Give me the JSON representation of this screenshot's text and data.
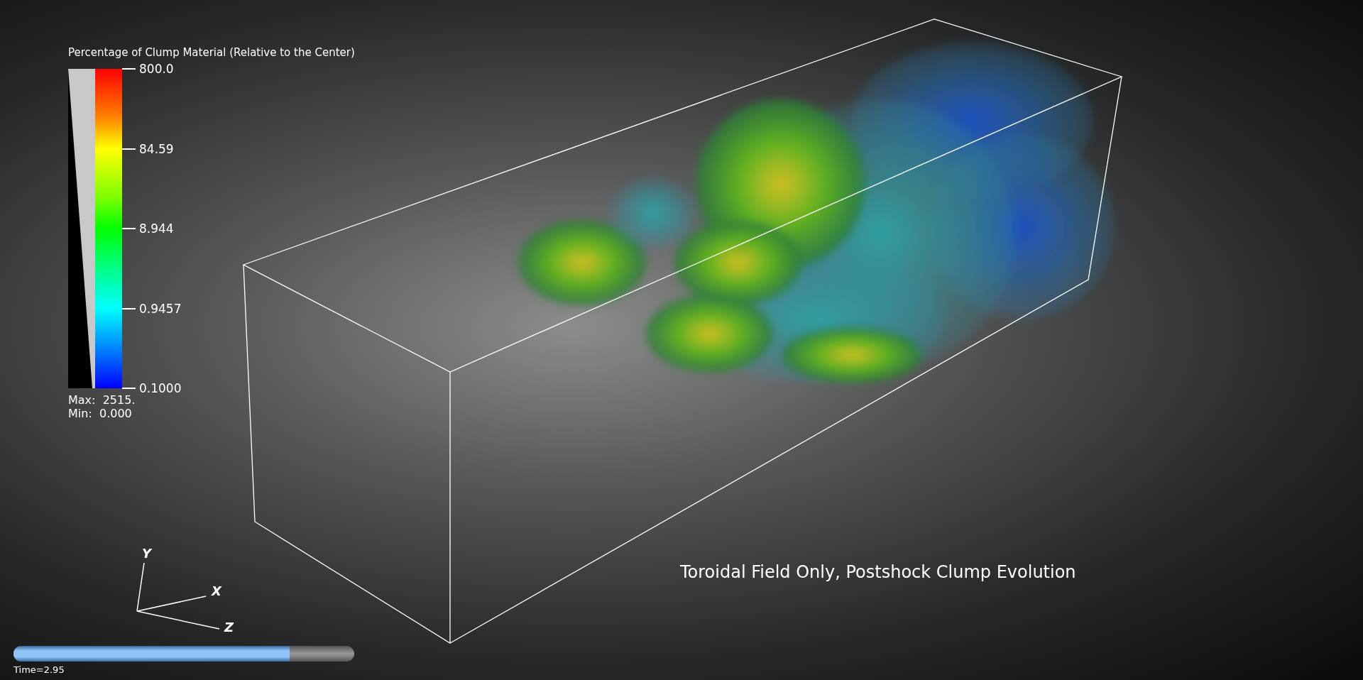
{
  "legend": {
    "title": "Percentage of Clump Material (Relative to the Center)",
    "ticks": [
      "800.0",
      "84.59",
      "8.944",
      "0.9457",
      "0.1000"
    ],
    "max": "Max:  2515.",
    "min": "Min:  0.000"
  },
  "plot_title": "Toroidal Field Only, Postshock Clump Evolution",
  "axes": [
    {
      "kind": "y",
      "label": "Y"
    },
    {
      "kind": "x",
      "label": "X"
    },
    {
      "kind": "z",
      "label": "Z"
    }
  ],
  "time_slider": {
    "level": 0.81,
    "label": "Time=2.95"
  }
}
